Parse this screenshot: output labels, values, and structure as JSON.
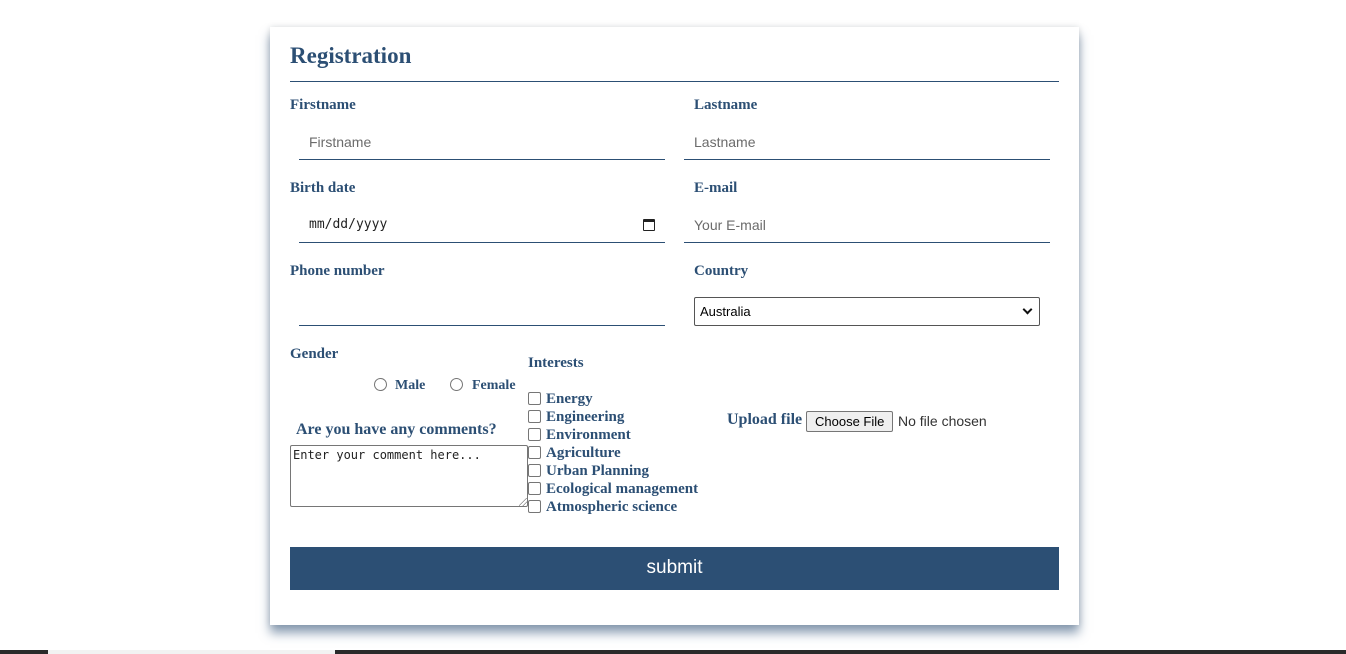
{
  "form": {
    "title": "Registration",
    "firstname": {
      "label": "Firstname",
      "placeholder": "Firstname"
    },
    "lastname": {
      "label": "Lastname",
      "placeholder": "Lastname"
    },
    "birthdate": {
      "label": "Birth date",
      "placeholder": "mm/dd/yyyy"
    },
    "email": {
      "label": "E-mail",
      "placeholder": "Your E-mail"
    },
    "phone": {
      "label": "Phone number",
      "placeholder": ""
    },
    "country": {
      "label": "Country",
      "selected": "Australia"
    },
    "gender": {
      "label": "Gender",
      "options": [
        "Male",
        "Female"
      ]
    },
    "interests": {
      "label": "Interests",
      "options": [
        "Energy",
        "Engineering",
        "Environment",
        "Agriculture",
        "Urban Planning",
        "Ecological management",
        "Atmospheric science"
      ]
    },
    "comments": {
      "label": "Are you have any comments?",
      "placeholder": "Enter your comment here..."
    },
    "upload": {
      "label": "Upload file",
      "button": "Choose File",
      "status": "No file chosen"
    },
    "submit_label": "submit"
  },
  "colors": {
    "primary": "#2c4f74",
    "background": "#ffffff"
  }
}
